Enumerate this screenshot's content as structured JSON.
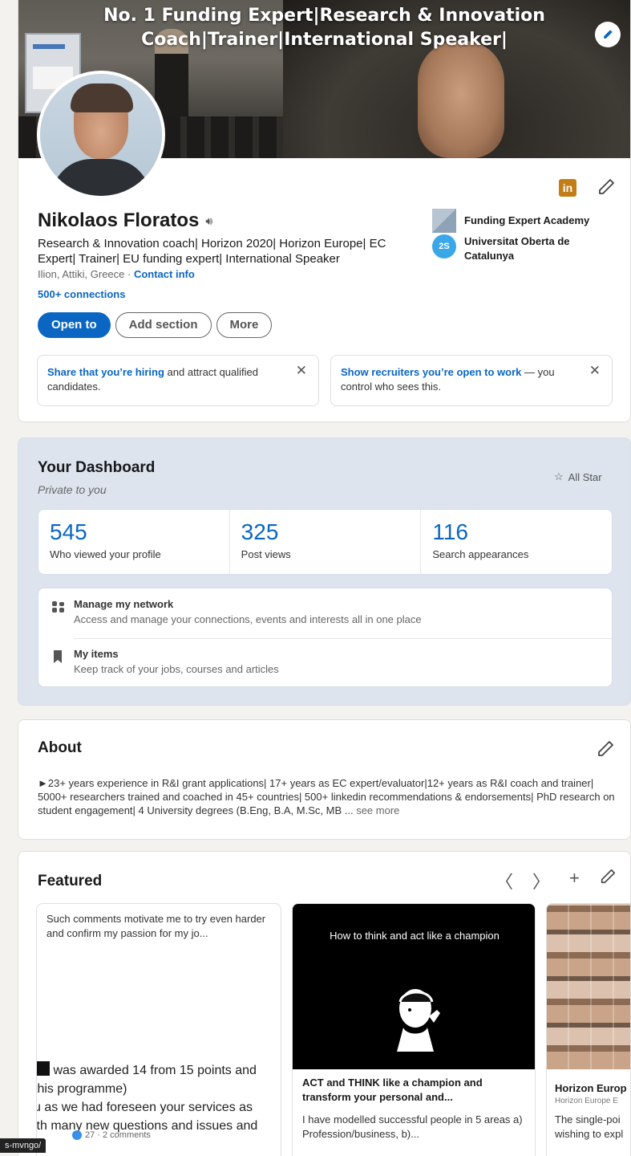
{
  "banner": {
    "title": "No. 1 Funding Expert|Research & Innovation Coach|Trainer|International Speaker|"
  },
  "profile": {
    "name": "Nikolaos Floratos",
    "headline": "Research & Innovation coach| Horizon 2020| Horizon Europe| EC Expert| Trainer| EU funding expert| International Speaker",
    "location": "Ilion, Attiki, Greece",
    "location_sep": " · ",
    "contact_info": "Contact info",
    "connections": "500+ connections",
    "linkedin_badge": "in",
    "buttons": {
      "open_to": "Open to",
      "add_section": "Add section",
      "more": "More"
    },
    "orgs": [
      {
        "name": "Funding Expert Academy"
      },
      {
        "name": "Universitat Oberta de Catalunya",
        "logo_text": "2S"
      }
    ],
    "notices": [
      {
        "link": "Share that you’re hiring",
        "text": " and attract qualified candidates."
      },
      {
        "link": "Show recruiters you’re open to work",
        "text": " — you control who sees this."
      }
    ]
  },
  "dashboard": {
    "title": "Your Dashboard",
    "subtitle": "Private to you",
    "all_star": "All Star",
    "stats": [
      {
        "value": "545",
        "label": "Who viewed your profile"
      },
      {
        "value": "325",
        "label": "Post views"
      },
      {
        "value": "116",
        "label": "Search appearances"
      }
    ],
    "items": [
      {
        "title": "Manage my network",
        "desc": "Access and manage your connections, events and interests all in one place"
      },
      {
        "title": "My items",
        "desc": "Keep track of your jobs, courses and articles"
      }
    ]
  },
  "about": {
    "title": "About",
    "text": "►23+ years experience in R&I grant applications| 17+ years as EC expert/evaluator|12+ years as R&I coach and trainer| 5000+ researchers trained and coached in 45+ countries| 500+ linkedin recommendations & endorsements| PhD research on student engagement| 4 University degrees (B.Eng, B.A, M.Sc, MB ...",
    "see_more": "see more"
  },
  "featured": {
    "title": "Featured",
    "cards": [
      {
        "text": "Such comments motivate me to try even harder and confirm my passion for my jo...",
        "snippet_lines": [
          "was awarded 14 from 15 points and",
          "this programme)",
          "u as we had foreseen your services as",
          "ith many new questions and issues and"
        ],
        "footer": "27 · 2 comments"
      },
      {
        "image_caption": "How to think and act like a champion",
        "title": "ACT and THINK like a champion and transform your personal and...",
        "desc": "I have modelled successful people in 5 areas a) Profession/business, b)..."
      },
      {
        "title": "Horizon Europ",
        "subtitle": "Horizon Europe E",
        "desc_lines": [
          "The single-poi",
          "wishing to expl"
        ]
      }
    ]
  },
  "status_url": "s-mvngo/"
}
